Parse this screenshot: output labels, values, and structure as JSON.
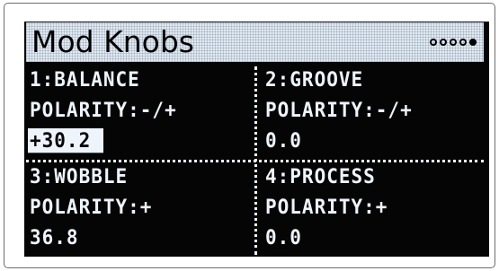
{
  "screen": {
    "title": "Mod Knobs",
    "pages": {
      "count": 5,
      "active_index": 4
    }
  },
  "knobs": [
    {
      "name": "1:BALANCE",
      "polarity": "POLARITY:-/+",
      "value": "+30.2",
      "selected": true
    },
    {
      "name": "2:GROOVE",
      "polarity": "POLARITY:-/+",
      "value": "0.0",
      "selected": false
    },
    {
      "name": "3:WOBBLE",
      "polarity": "POLARITY:+",
      "value": "36.8",
      "selected": false
    },
    {
      "name": "4:PROCESS",
      "polarity": "POLARITY:+",
      "value": "0.0",
      "selected": false
    }
  ],
  "colors": {
    "screen_background": "#050505",
    "text": "#eef4fb",
    "header_background": "#dfeaf6"
  }
}
